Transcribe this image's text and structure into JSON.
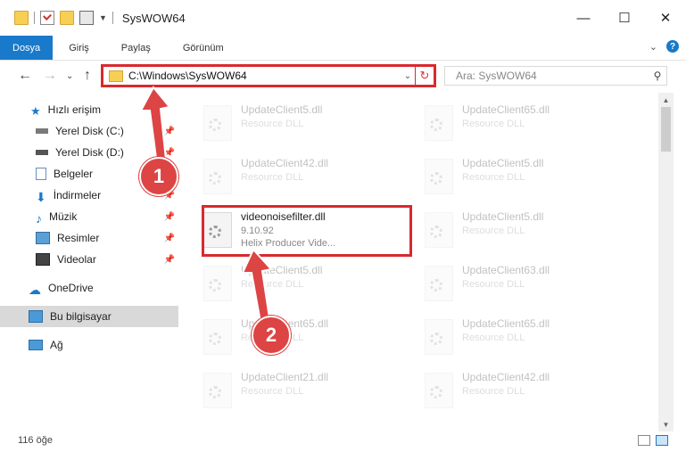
{
  "window": {
    "title": "SysWOW64",
    "controls": {
      "minimize": "—",
      "maximize": "☐",
      "close": "✕"
    }
  },
  "ribbon": {
    "tabs": [
      "Dosya",
      "Giriş",
      "Paylaş",
      "Görünüm"
    ],
    "help": "?"
  },
  "address": {
    "path": "C:\\Windows\\SysWOW64",
    "search_placeholder": "Ara: SysWOW64"
  },
  "nav": {
    "items": [
      {
        "label": "Hızlı erişim",
        "icon": "star-icon",
        "pinned": false,
        "selected": false
      },
      {
        "label": "Yerel Disk (C:)",
        "icon": "drive-icon",
        "pinned": true,
        "selected": false
      },
      {
        "label": "Yerel Disk (D:)",
        "icon": "drive-icon",
        "pinned": true,
        "selected": false
      },
      {
        "label": "Belgeler",
        "icon": "documents-icon",
        "pinned": true,
        "selected": false
      },
      {
        "label": "İndirmeler",
        "icon": "download-icon",
        "pinned": true,
        "selected": false
      },
      {
        "label": "Müzik",
        "icon": "music-icon",
        "pinned": true,
        "selected": false
      },
      {
        "label": "Resimler",
        "icon": "pictures-icon",
        "pinned": true,
        "selected": false
      },
      {
        "label": "Videolar",
        "icon": "videos-icon",
        "pinned": true,
        "selected": false
      },
      {
        "label": "OneDrive",
        "icon": "cloud-icon",
        "pinned": false,
        "selected": false
      },
      {
        "label": "Bu bilgisayar",
        "icon": "computer-icon",
        "pinned": false,
        "selected": true
      },
      {
        "label": "Ağ",
        "icon": "network-icon",
        "pinned": false,
        "selected": false
      }
    ]
  },
  "files": [
    {
      "name": "UpdateClient5.dll",
      "desc": "Resource DLL"
    },
    {
      "name": "UpdateClient65.dll",
      "desc": "Resource DLL"
    },
    {
      "name": "UpdateClient42.dll",
      "desc": "Resource DLL"
    },
    {
      "name": "UpdateClient5.dll",
      "desc": "Resource DLL"
    },
    {
      "name": "videonoisefilter.dll",
      "version": "9.10.92",
      "desc": "Helix Producer Vide...",
      "highlighted": true
    },
    {
      "name": "UpdateClient5.dll",
      "desc": "Resource DLL"
    },
    {
      "name": "UpdateClient5.dll",
      "desc": "Resource DLL"
    },
    {
      "name": "UpdateClient63.dll",
      "desc": "Resource DLL"
    },
    {
      "name": "UpdateClient65.dll",
      "desc": "Resource DLL"
    },
    {
      "name": "UpdateClient65.dll",
      "desc": "Resource DLL"
    },
    {
      "name": "UpdateClient21.dll",
      "desc": "Resource DLL"
    },
    {
      "name": "UpdateClient42.dll",
      "desc": "Resource DLL"
    }
  ],
  "status": {
    "item_count": "116 öğe"
  },
  "annotations": {
    "step1": "1",
    "step2": "2",
    "color": "#dd4444",
    "highlight_color": "#d9292e"
  }
}
